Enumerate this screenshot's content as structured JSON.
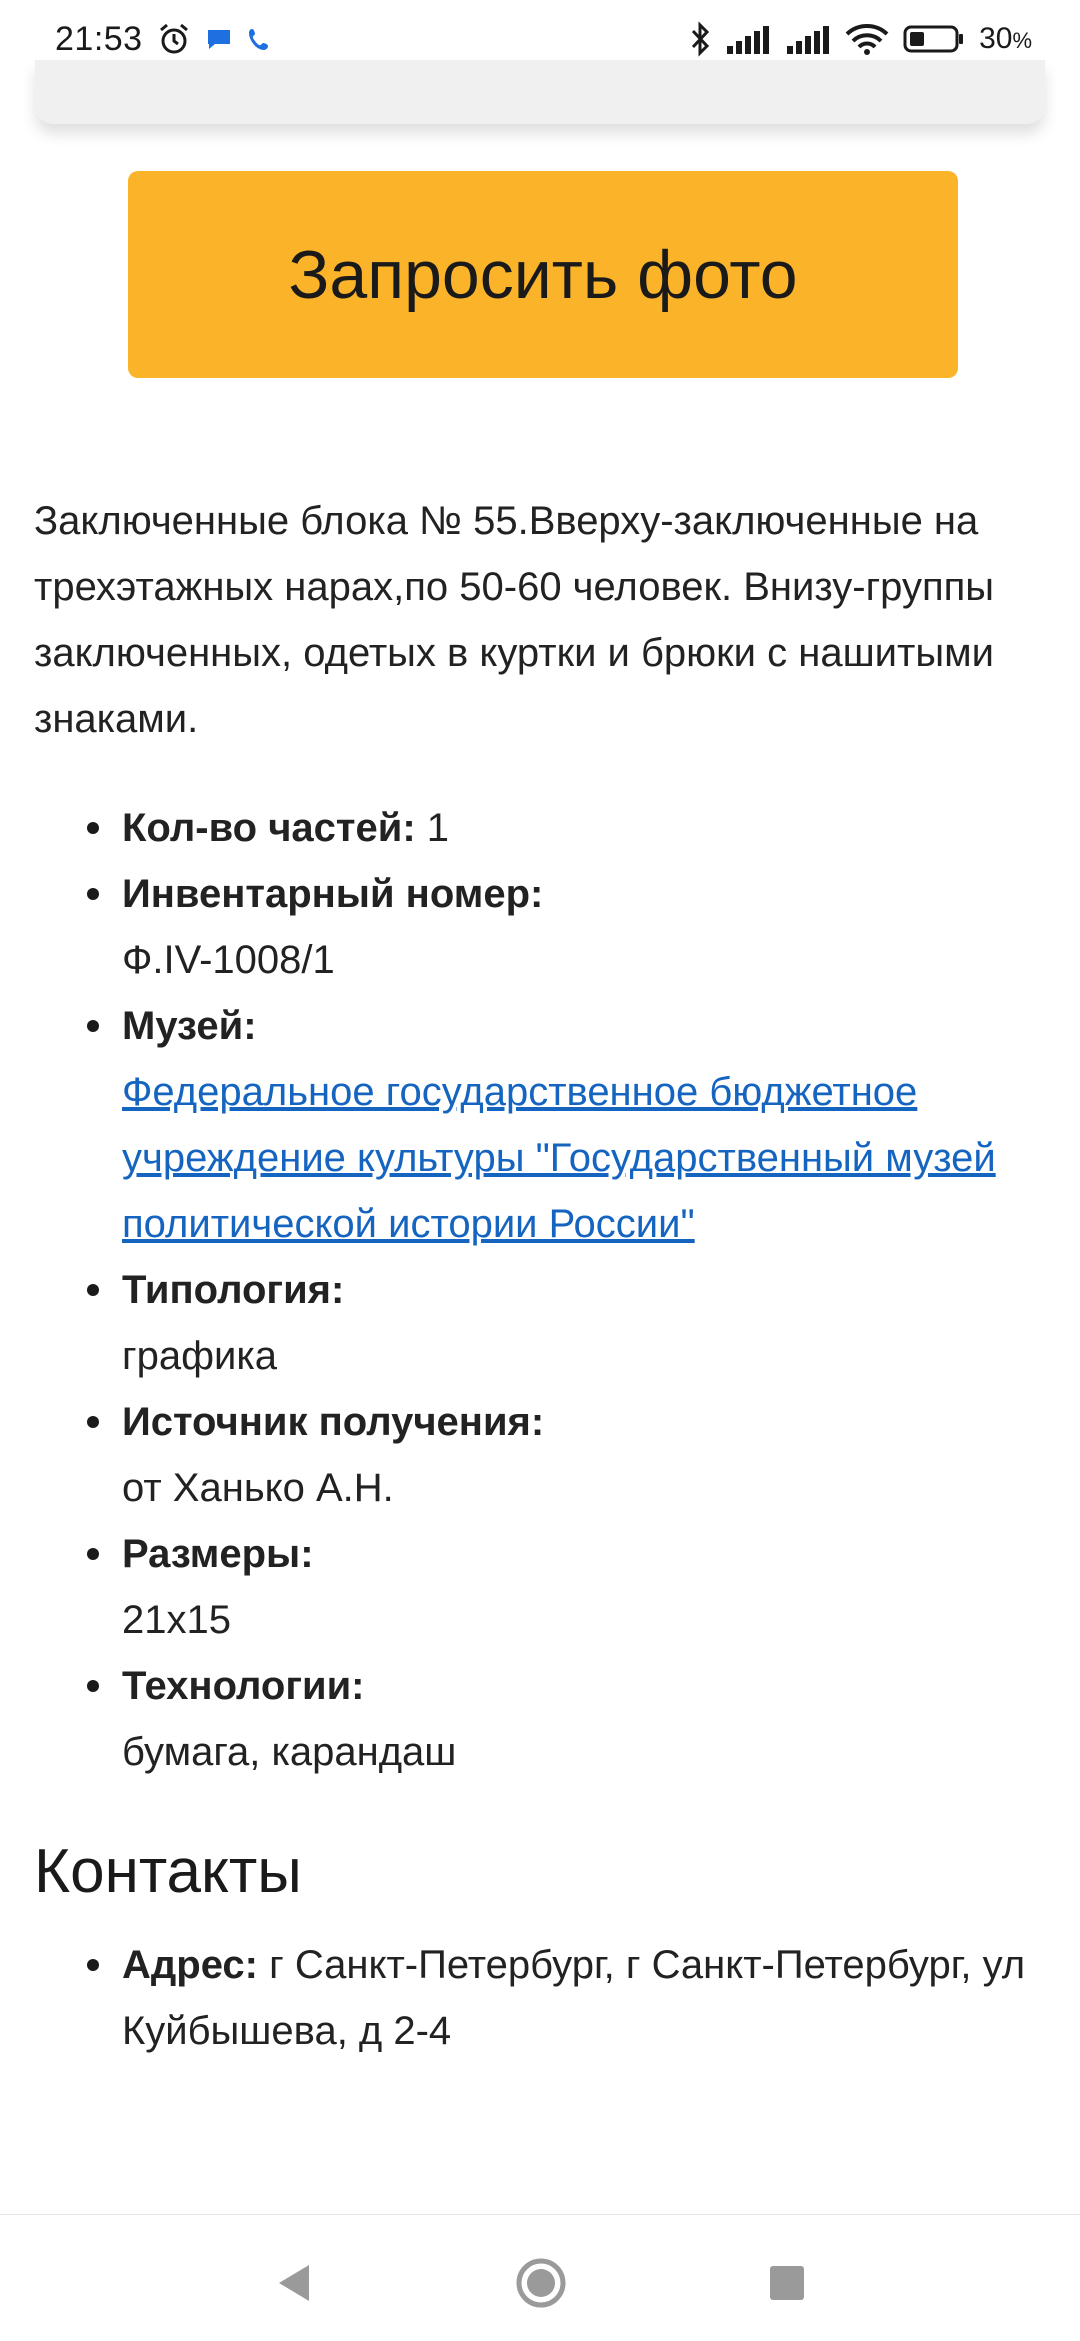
{
  "status_bar": {
    "time": "21:53",
    "battery_percent": "30",
    "battery_unit": "%",
    "icons": [
      "alarm-icon",
      "message-icon",
      "phone-icon",
      "bluetooth-icon",
      "signal-icon",
      "signal-icon",
      "wifi-icon",
      "battery-icon"
    ]
  },
  "request_photo_button": {
    "label": "Запросить фото",
    "color": "#fbb429"
  },
  "description": "Заключенные блока № 55.Вверху-заключенные на трехэтажных нарах,по 50-60 человек. Внизу-группы заключенных, одетых в куртки и брюки с нашитыми знаками.",
  "properties": [
    {
      "label": "Кол-во частей:",
      "value": "1"
    },
    {
      "label": "Инвентарный номер:",
      "value": "Ф.IV-1008/1"
    },
    {
      "label": "Музей:",
      "value": "Федеральное государственное бюджетное учреждение культуры \"Государственный музей политической истории России\"",
      "link": true
    },
    {
      "label": "Типология:",
      "value": "графика"
    },
    {
      "label": "Источник получения:",
      "value": "от Ханько А.Н."
    },
    {
      "label": "Размеры:",
      "value": "21x15"
    },
    {
      "label": "Технологии:",
      "value": "бумага, карандаш"
    }
  ],
  "contacts": {
    "title": "Контакты",
    "address_label": "Адрес:",
    "address_value": "г Санкт-Петербург, г Санкт-Петербург, ул Куйбышева, д 2-4"
  },
  "nav_bar": {
    "icons": [
      "back-icon",
      "home-icon",
      "recents-icon"
    ]
  },
  "colors": {
    "accent": "#fbb429",
    "link": "#1565c0"
  }
}
